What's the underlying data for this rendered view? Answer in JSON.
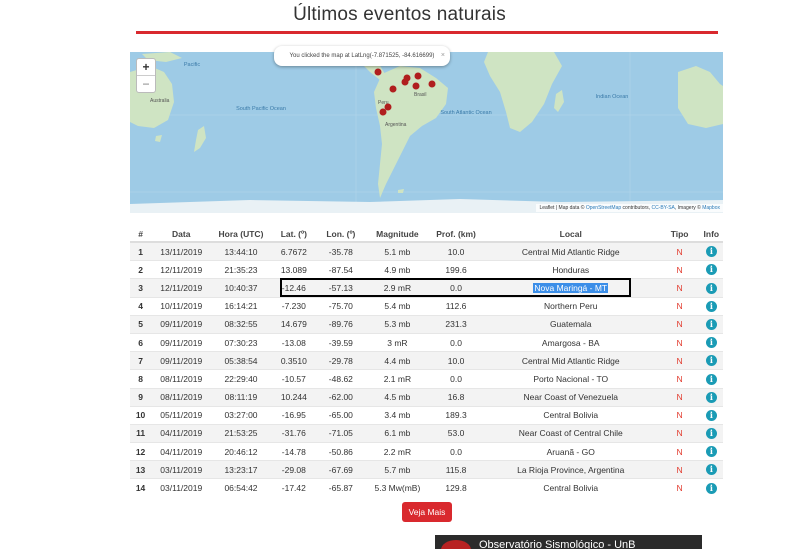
{
  "page": {
    "title": "Últimos eventos naturais"
  },
  "map": {
    "popup": "You clicked the map at LatLng(-7.871525, -84.616699)",
    "zoom_in": "+",
    "zoom_out": "−",
    "attribution_prefix": "Leaflet | Map data © ",
    "osm": "OpenStreetMap",
    "attribution_mid": " contributors, ",
    "license": "CC-BY-SA",
    "imagery": ", Imagery © ",
    "mapbox": "Mapbox",
    "labels": {
      "australia": "Australia",
      "south_pacific": "South Pacific Ocean",
      "north_pacific": "Pacific",
      "south_atlantic": "South Atlantic Ocean",
      "indian": "Indian Ocean",
      "brasil": "Brasil",
      "peru": "Peru",
      "argentina": "Argentina"
    }
  },
  "table": {
    "columns": [
      "#",
      "Data",
      "Hora (UTC)",
      "Lat. (º)",
      "Lon. (º)",
      "Magnitude",
      "Prof. (km)",
      "Local",
      "Tipo",
      "Info"
    ],
    "rows": [
      {
        "n": "1",
        "date": "13/11/2019",
        "time": "13:44:10",
        "lat": "6.7672",
        "lon": "-35.78",
        "mag": "5.1 mb",
        "depth": "10.0",
        "local": "Central Mid Atlantic Ridge",
        "tipo": "N"
      },
      {
        "n": "2",
        "date": "12/11/2019",
        "time": "21:35:23",
        "lat": "13.089",
        "lon": "-87.54",
        "mag": "4.9 mb",
        "depth": "199.6",
        "local": "Honduras",
        "tipo": "N"
      },
      {
        "n": "3",
        "date": "12/11/2019",
        "time": "10:40:37",
        "lat": "-12.46",
        "lon": "-57.13",
        "mag": "2.9 mR",
        "depth": "0.0",
        "local": "Nova Maringá - MT",
        "tipo": "N"
      },
      {
        "n": "4",
        "date": "10/11/2019",
        "time": "16:14:21",
        "lat": "-7.230",
        "lon": "-75.70",
        "mag": "5.4 mb",
        "depth": "112.6",
        "local": "Northern Peru",
        "tipo": "N"
      },
      {
        "n": "5",
        "date": "09/11/2019",
        "time": "08:32:55",
        "lat": "14.679",
        "lon": "-89.76",
        "mag": "5.3 mb",
        "depth": "231.3",
        "local": "Guatemala",
        "tipo": "N"
      },
      {
        "n": "6",
        "date": "09/11/2019",
        "time": "07:30:23",
        "lat": "-13.08",
        "lon": "-39.59",
        "mag": "3 mR",
        "depth": "0.0",
        "local": "Amargosa - BA",
        "tipo": "N"
      },
      {
        "n": "7",
        "date": "09/11/2019",
        "time": "05:38:54",
        "lat": "0.3510",
        "lon": "-29.78",
        "mag": "4.4 mb",
        "depth": "10.0",
        "local": "Central Mid Atlantic Ridge",
        "tipo": "N"
      },
      {
        "n": "8",
        "date": "08/11/2019",
        "time": "22:29:40",
        "lat": "-10.57",
        "lon": "-48.62",
        "mag": "2.1 mR",
        "depth": "0.0",
        "local": "Porto Nacional - TO",
        "tipo": "N"
      },
      {
        "n": "9",
        "date": "08/11/2019",
        "time": "08:11:19",
        "lat": "10.244",
        "lon": "-62.00",
        "mag": "4.5 mb",
        "depth": "16.8",
        "local": "Near Coast of Venezuela",
        "tipo": "N"
      },
      {
        "n": "10",
        "date": "05/11/2019",
        "time": "03:27:00",
        "lat": "-16.95",
        "lon": "-65.00",
        "mag": "3.4 mb",
        "depth": "189.3",
        "local": "Central Bolivia",
        "tipo": "N"
      },
      {
        "n": "11",
        "date": "04/11/2019",
        "time": "21:53:25",
        "lat": "-31.76",
        "lon": "-71.05",
        "mag": "6.1 mb",
        "depth": "53.0",
        "local": "Near Coast of Central Chile",
        "tipo": "N"
      },
      {
        "n": "12",
        "date": "04/11/2019",
        "time": "20:46:12",
        "lat": "-14.78",
        "lon": "-50.86",
        "mag": "2.2 mR",
        "depth": "0.0",
        "local": "Aruanã - GO",
        "tipo": "N"
      },
      {
        "n": "13",
        "date": "03/11/2019",
        "time": "13:23:17",
        "lat": "-29.08",
        "lon": "-67.69",
        "mag": "5.7 mb",
        "depth": "115.8",
        "local": "La Rioja Province, Argentina",
        "tipo": "N"
      },
      {
        "n": "14",
        "date": "03/11/2019",
        "time": "06:54:42",
        "lat": "-17.42",
        "lon": "-65.87",
        "mag": "5.3 Mw(mB)",
        "depth": "129.8",
        "local": "Central Bolivia",
        "tipo": "N"
      }
    ]
  },
  "buttons": {
    "veja_mais": "Veja Mais"
  },
  "video": {
    "title": "Observatório Sismológico - UnB"
  },
  "colors": {
    "accent": "#d9292e",
    "info": "#1a9bb5",
    "ocean": "#9ecbe6",
    "land": "#cfe4c3",
    "marker": "#b01e1e",
    "selection": "#3b8ee8"
  },
  "icons": {
    "info": "info-circle-icon",
    "marker": "map-marker-icon"
  }
}
